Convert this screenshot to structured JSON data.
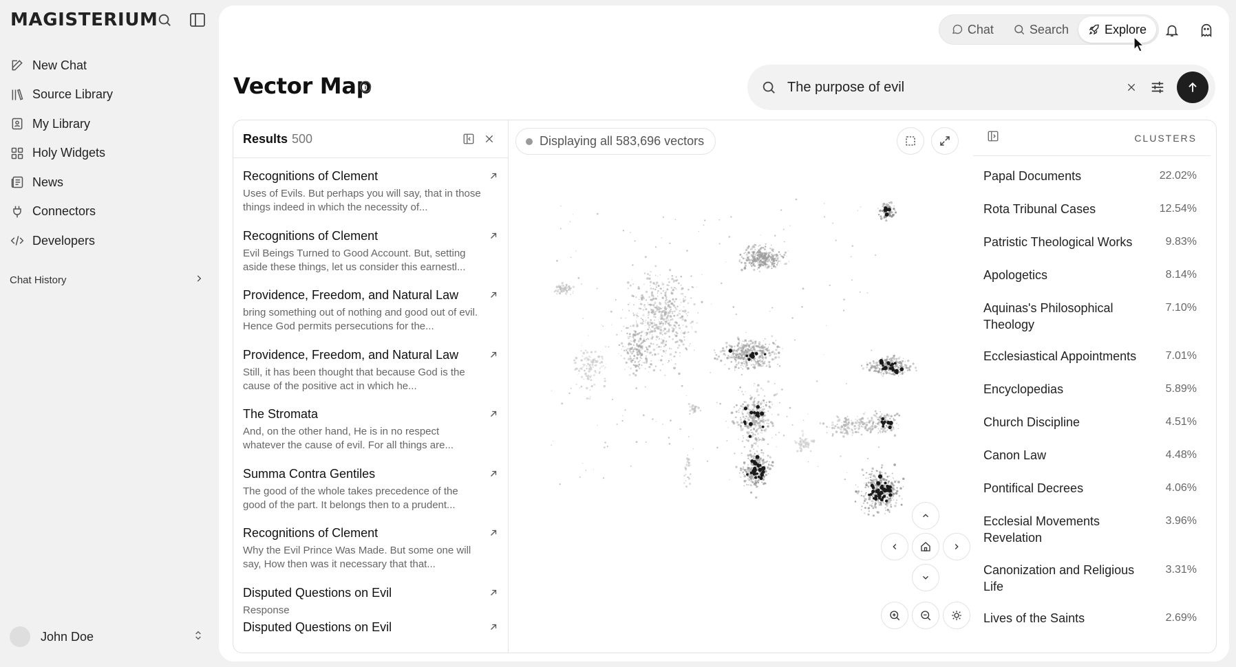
{
  "brand": "MAGISTERIUM",
  "sidebar": {
    "items": [
      {
        "label": "New Chat",
        "icon": "edit-icon"
      },
      {
        "label": "Source Library",
        "icon": "library-icon"
      },
      {
        "label": "My Library",
        "icon": "bookmark-icon"
      },
      {
        "label": "Holy Widgets",
        "icon": "grid-icon"
      },
      {
        "label": "News",
        "icon": "newspaper-icon"
      },
      {
        "label": "Connectors",
        "icon": "plug-icon"
      },
      {
        "label": "Developers",
        "icon": "code-icon"
      }
    ],
    "chat_history": "Chat History",
    "user": "John Doe"
  },
  "topnav": {
    "tabs": [
      {
        "label": "Chat",
        "icon": "chat-icon"
      },
      {
        "label": "Search",
        "icon": "search-icon"
      },
      {
        "label": "Explore",
        "icon": "rocket-icon"
      }
    ],
    "active": "Explore"
  },
  "page": {
    "title": "Vector Map"
  },
  "search": {
    "value": "The purpose of evil"
  },
  "results": {
    "title": "Results",
    "count": "500",
    "items": [
      {
        "title": "Recognitions of Clement",
        "snippet": "Uses of Evils. But perhaps you will say, that in those things indeed in which the necessity of..."
      },
      {
        "title": "Recognitions of Clement",
        "snippet": "Evil Beings Turned to Good Account. But, setting aside these things, let us consider this earnestl..."
      },
      {
        "title": "Providence, Freedom, and Natural Law",
        "snippet": "bring something out of nothing and good out of evil. Hence God permits persecutions for the..."
      },
      {
        "title": "Providence, Freedom, and Natural Law",
        "snippet": "Still, it has been thought that because God is the cause of the positive act in which he..."
      },
      {
        "title": "The Stromata",
        "snippet": "And, on the other hand, He is in no respect whatever the cause of evil. For all things are..."
      },
      {
        "title": "Summa Contra Gentiles",
        "snippet": "The good of the whole takes precedence of the good of the part. It belongs then to a prudent..."
      },
      {
        "title": "Recognitions of Clement",
        "snippet": "Why the Evil Prince Was Made. But some one will say, How then was it necessary that that..."
      },
      {
        "title": "Disputed Questions on Evil",
        "snippet": "Response"
      },
      {
        "title": "Disputed Questions on Evil",
        "snippet": ""
      }
    ]
  },
  "map": {
    "status": "Displaying all 583,696 vectors"
  },
  "clusters": {
    "title": "CLUSTERS",
    "items": [
      {
        "name": "Papal Documents",
        "pct": "22.02%"
      },
      {
        "name": "Rota Tribunal Cases",
        "pct": "12.54%"
      },
      {
        "name": "Patristic Theological Works",
        "pct": "9.83%"
      },
      {
        "name": "Apologetics",
        "pct": "8.14%"
      },
      {
        "name": "Aquinas's Philosophical Theology",
        "pct": "7.10%"
      },
      {
        "name": "Ecclesiastical Appointments",
        "pct": "7.01%"
      },
      {
        "name": "Encyclopedias",
        "pct": "5.89%"
      },
      {
        "name": "Church Discipline",
        "pct": "4.51%"
      },
      {
        "name": "Canon Law",
        "pct": "4.48%"
      },
      {
        "name": "Pontifical Decrees",
        "pct": "4.06%"
      },
      {
        "name": "Ecclesial Movements Revelation",
        "pct": "3.96%"
      },
      {
        "name": "Canonization and Religious Life",
        "pct": "3.31%"
      },
      {
        "name": "Lives of the Saints",
        "pct": "2.69%"
      }
    ]
  }
}
